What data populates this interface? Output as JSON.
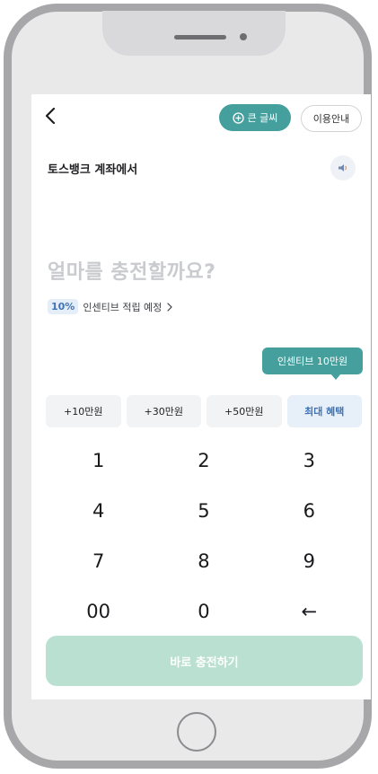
{
  "header": {
    "big_text_label": "큰 글씨",
    "guide_label": "이용안내"
  },
  "source": {
    "label": "토스뱅크 계좌에서"
  },
  "amount": {
    "prompt": "얼마를 충전할까요?"
  },
  "incentive": {
    "percent": "10%",
    "text": "인센티브 적립 예정"
  },
  "tooltip": {
    "text": "인센티브 10만원"
  },
  "quick_amounts": [
    {
      "label": "+10만원"
    },
    {
      "label": "+30만원"
    },
    {
      "label": "+50만원"
    },
    {
      "label": "최대 혜택"
    }
  ],
  "keypad": [
    "1",
    "2",
    "3",
    "4",
    "5",
    "6",
    "7",
    "8",
    "9",
    "00",
    "0",
    "←"
  ],
  "submit": {
    "label": "바로 충전하기"
  },
  "colors": {
    "accent": "#45a09d",
    "submit_disabled": "#b9e0d1",
    "badge_blue": "#3f74b8",
    "placeholder_gray": "#c9cbcf"
  },
  "icons": {
    "back": "chevron-left-icon",
    "zoom": "zoom-plus-icon",
    "speaker": "speaker-icon",
    "chevron": "chevron-right-icon",
    "home": "home-button-icon"
  }
}
